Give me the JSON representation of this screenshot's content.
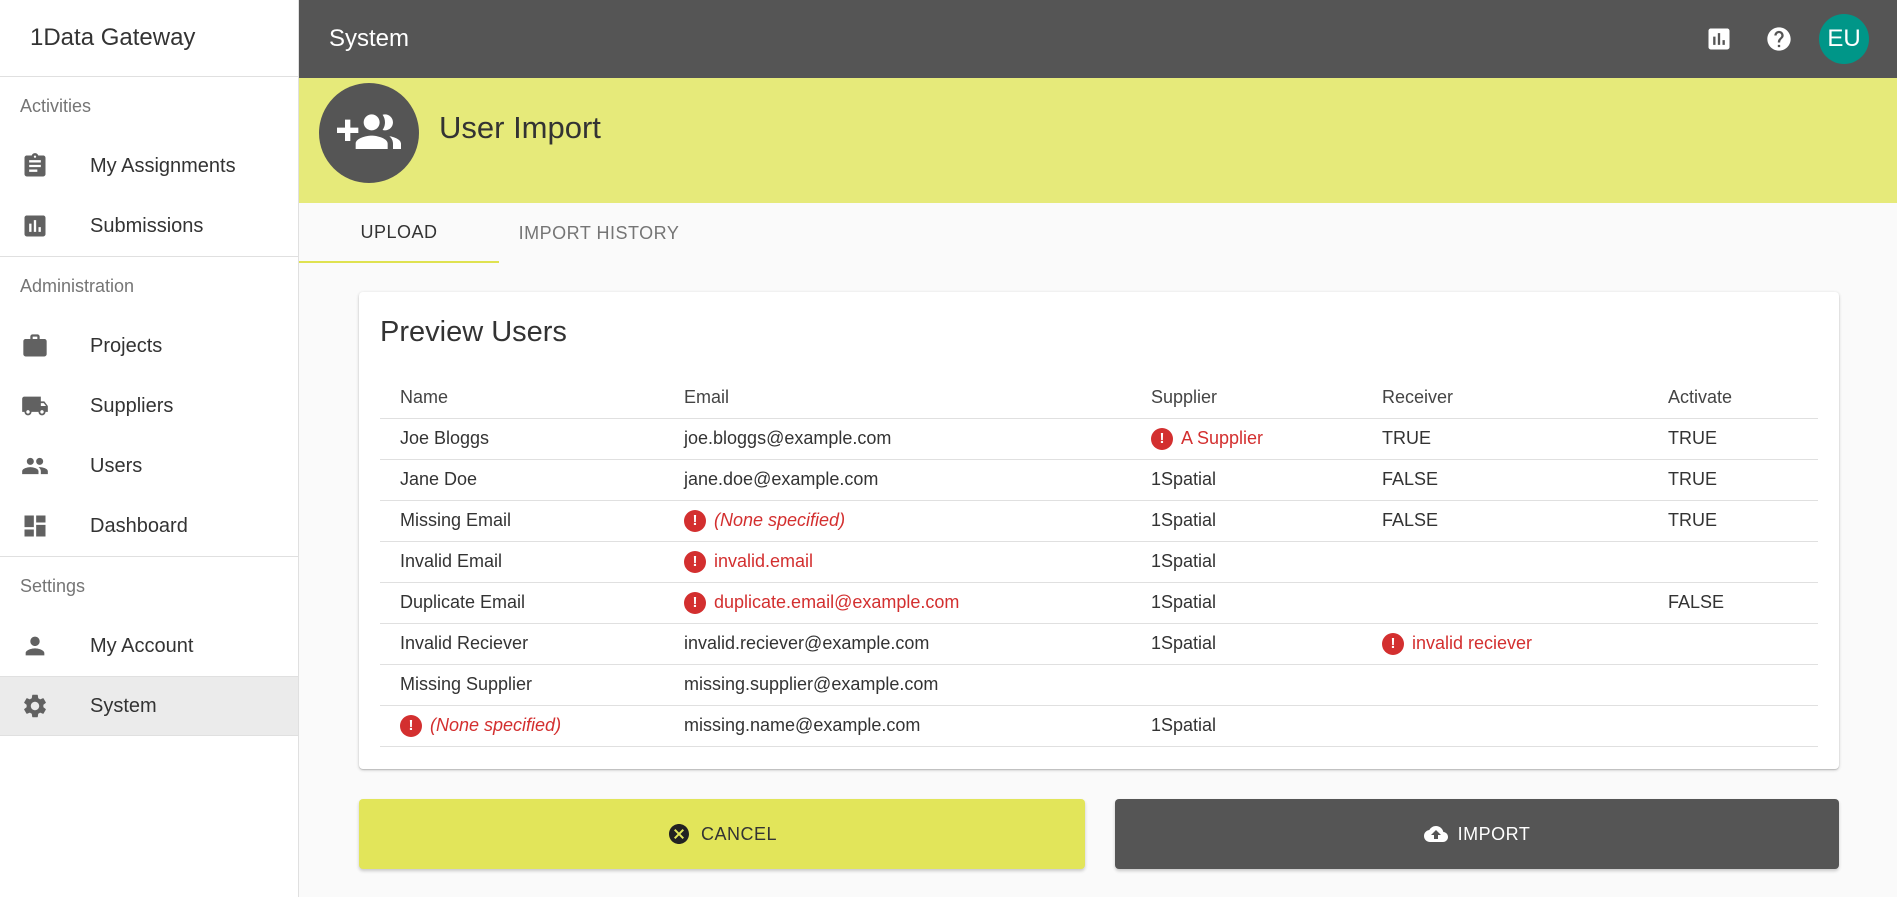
{
  "app": {
    "brand": "1Data Gateway"
  },
  "sidebar": {
    "sections": [
      {
        "heading": "Activities",
        "items": [
          {
            "label": "My Assignments",
            "icon": "clipboard-icon"
          },
          {
            "label": "Submissions",
            "icon": "bar-chart-icon"
          }
        ]
      },
      {
        "heading": "Administration",
        "items": [
          {
            "label": "Projects",
            "icon": "briefcase-icon"
          },
          {
            "label": "Suppliers",
            "icon": "truck-icon"
          },
          {
            "label": "Users",
            "icon": "people-icon"
          },
          {
            "label": "Dashboard",
            "icon": "dashboard-icon"
          }
        ]
      },
      {
        "heading": "Settings",
        "items": [
          {
            "label": "My Account",
            "icon": "person-icon"
          },
          {
            "label": "System",
            "icon": "gear-icon",
            "active": true
          }
        ]
      }
    ]
  },
  "topbar": {
    "title": "System",
    "avatar_initials": "EU"
  },
  "hero": {
    "title": "User Import",
    "icon": "add-group-icon"
  },
  "tabs": [
    {
      "label": "UPLOAD",
      "active": true
    },
    {
      "label": "IMPORT HISTORY",
      "active": false
    }
  ],
  "preview": {
    "title": "Preview Users",
    "columns": [
      "Name",
      "Email",
      "Supplier",
      "Receiver",
      "Activate"
    ],
    "rows": [
      {
        "name": "Joe Bloggs",
        "email": "joe.bloggs@example.com",
        "supplier": "A Supplier",
        "receiver": "TRUE",
        "activate": "TRUE",
        "errors": [
          "supplier"
        ]
      },
      {
        "name": "Jane Doe",
        "email": "jane.doe@example.com",
        "supplier": "1Spatial",
        "receiver": "FALSE",
        "activate": "TRUE",
        "errors": []
      },
      {
        "name": "Missing Email",
        "email": "(None specified)",
        "supplier": "1Spatial",
        "receiver": "FALSE",
        "activate": "TRUE",
        "errors": [
          "email"
        ]
      },
      {
        "name": "Invalid Email",
        "email": "invalid.email",
        "supplier": "1Spatial",
        "receiver": "",
        "activate": "",
        "errors": [
          "email"
        ]
      },
      {
        "name": "Duplicate Email",
        "email": "duplicate.email@example.com",
        "supplier": "1Spatial",
        "receiver": "",
        "activate": "FALSE",
        "errors": [
          "email"
        ]
      },
      {
        "name": "Invalid Reciever",
        "email": "invalid.reciever@example.com",
        "supplier": "1Spatial",
        "receiver": "invalid reciever",
        "activate": "",
        "errors": [
          "receiver"
        ]
      },
      {
        "name": "Missing Supplier",
        "email": "missing.supplier@example.com",
        "supplier": "",
        "receiver": "",
        "activate": "",
        "errors": []
      },
      {
        "name": "(None specified)",
        "email": "missing.name@example.com",
        "supplier": "1Spatial",
        "receiver": "",
        "activate": "",
        "errors": [
          "name"
        ]
      }
    ]
  },
  "actions": {
    "cancel_label": "CANCEL",
    "import_label": "IMPORT"
  },
  "colors": {
    "accent": "#e2e55a",
    "hero_bg": "#e6ea7a",
    "dark": "#555555",
    "error": "#d32f2f",
    "avatar": "#009688"
  }
}
